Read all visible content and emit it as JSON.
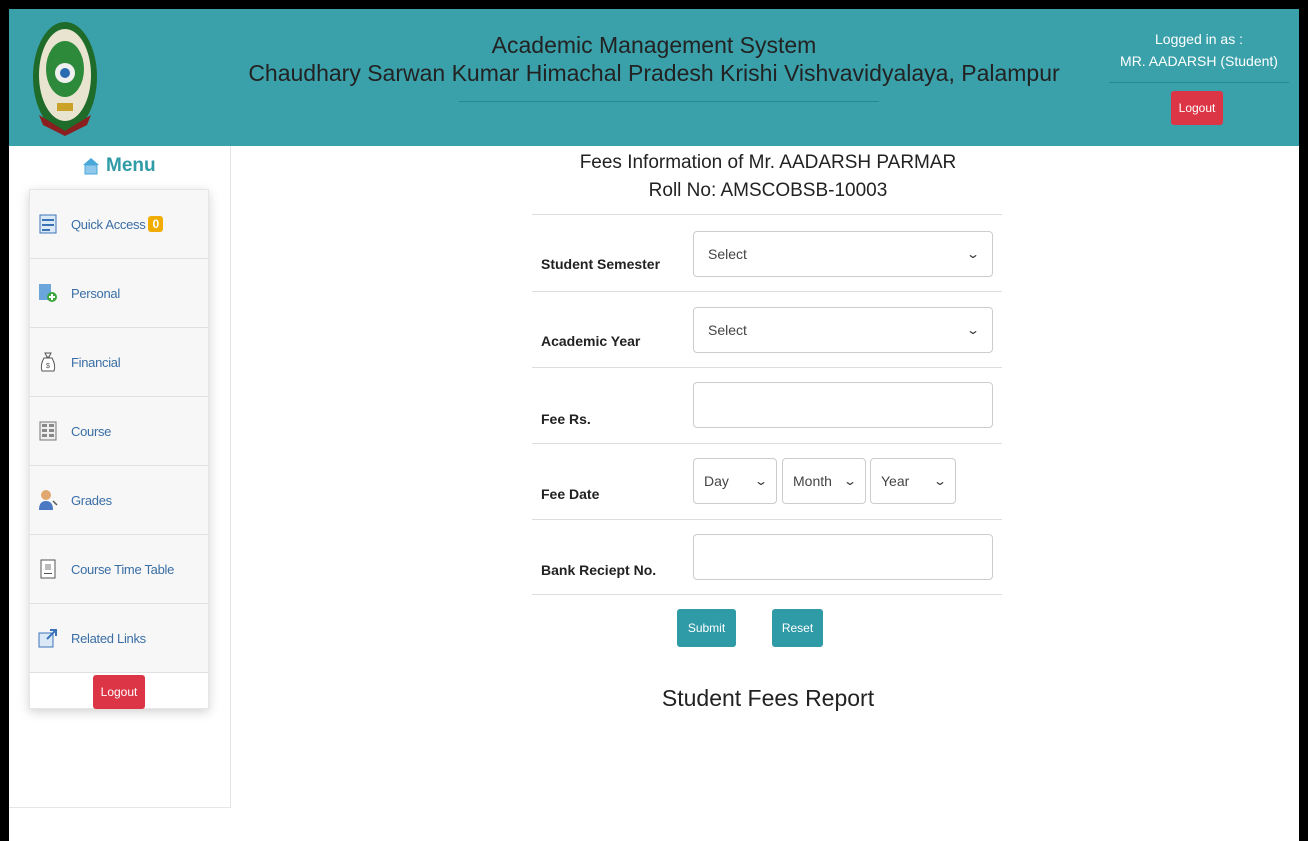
{
  "header": {
    "title": "Academic Management System",
    "subtitle": "Chaudhary Sarwan Kumar Himachal Pradesh Krishi Vishvavidyalaya, Palampur",
    "logged_in_label": "Logged in as :",
    "user_name": "MR. AADARSH (Student)",
    "logout_label": "Logout",
    "brand_color": "#3aa1ab"
  },
  "sidebar": {
    "menu_label": "Menu",
    "items": [
      {
        "label": "Quick Access",
        "icon": "form-icon",
        "badge": "0"
      },
      {
        "label": "Personal",
        "icon": "personal-icon"
      },
      {
        "label": "Financial",
        "icon": "money-bag-icon"
      },
      {
        "label": "Course",
        "icon": "course-grid-icon"
      },
      {
        "label": "Grades",
        "icon": "user-grades-icon"
      },
      {
        "label": "Course Time Table",
        "icon": "timetable-icon"
      },
      {
        "label": "Related Links",
        "icon": "external-link-icon"
      }
    ],
    "logout_label": "Logout"
  },
  "main": {
    "title_line1": "Fees Information of Mr. AADARSH PARMAR",
    "title_line2": "Roll No: AMSCOBSB-10003",
    "form": {
      "semester_label": "Student Semester",
      "semester_value": "Select",
      "year_label": "Academic Year",
      "year_value": "Select",
      "fee_label": "Fee Rs.",
      "fee_value": "",
      "date_label": "Fee Date",
      "day_value": "Day",
      "month_value": "Month",
      "year_part_value": "Year",
      "receipt_label": "Bank Reciept No.",
      "receipt_value": ""
    },
    "submit_label": "Submit",
    "reset_label": "Reset",
    "report_title": "Student Fees Report"
  }
}
